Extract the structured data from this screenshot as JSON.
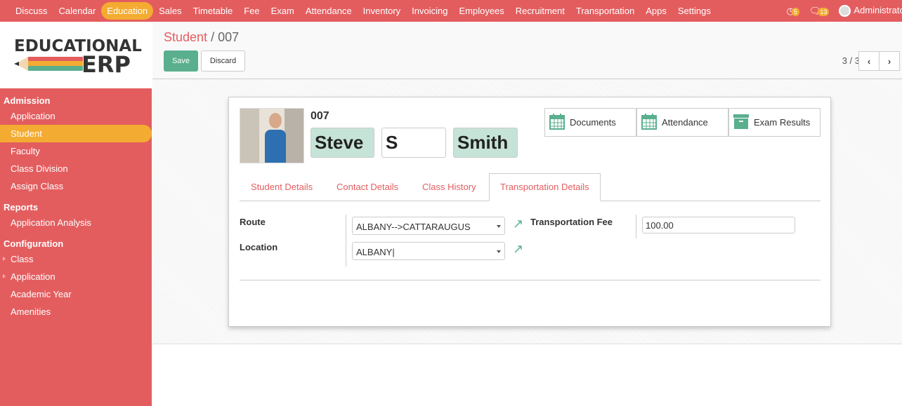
{
  "topbar": {
    "menus": [
      "Discuss",
      "Calendar",
      "Education",
      "Sales",
      "Timetable",
      "Fee",
      "Exam",
      "Attendance",
      "Inventory",
      "Invoicing",
      "Employees",
      "Recruitment",
      "Transportation",
      "Apps",
      "Settings"
    ],
    "active": "Education",
    "activity_count": "5",
    "message_count": "13",
    "user": "Administrator"
  },
  "logo": {
    "line1": "EDUCATIONAL",
    "line2": "ERP"
  },
  "sidebar": {
    "sections": [
      {
        "title": "Admission",
        "items": [
          "Application",
          "Student",
          "Faculty",
          "Class Division",
          "Assign Class"
        ]
      },
      {
        "title": "Reports",
        "items": [
          "Application Analysis"
        ]
      },
      {
        "title": "Configuration",
        "items": [
          "Class",
          "Application",
          "Academic Year",
          "Amenities"
        ]
      }
    ],
    "active": "Student"
  },
  "control": {
    "breadcrumb_parent": "Student",
    "breadcrumb_sep": "/",
    "breadcrumb_current": "007",
    "save": "Save",
    "discard": "Discard",
    "pager": "3 / 3"
  },
  "record": {
    "code": "007",
    "first_name": "Steve",
    "middle_name": "S",
    "last_name": "Smith",
    "smart_buttons": [
      {
        "label": "Documents",
        "icon": "calendar-icon"
      },
      {
        "label": "Attendance",
        "icon": "calendar-icon"
      },
      {
        "label": "Exam Results",
        "icon": "archive-icon"
      }
    ],
    "tabs": [
      "Student Details",
      "Contact Details",
      "Class History",
      "Transportation Details"
    ],
    "active_tab": "Transportation Details",
    "route_label": "Route",
    "route_value": "ALBANY-->CATTARAUGUS",
    "location_label": "Location",
    "location_value": "ALBANY",
    "fee_label": "Transportation Fee",
    "fee_value": "100.00"
  },
  "colors": {
    "brand": "#e35d5f",
    "accent": "#f4ab31",
    "primary": "#5aaf8e"
  }
}
